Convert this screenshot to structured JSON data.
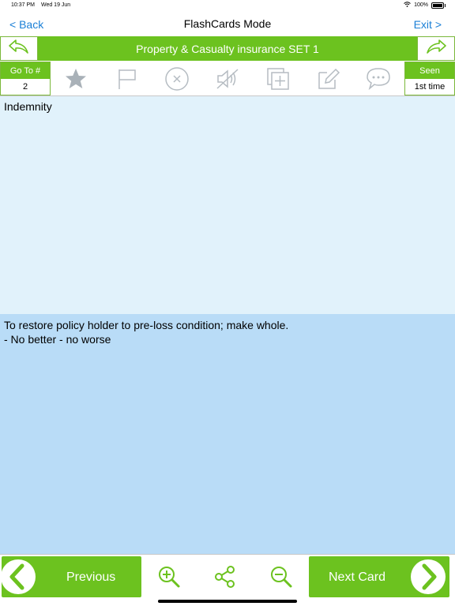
{
  "status": {
    "time": "10:37 PM",
    "date": "Wed 19 Jun",
    "battery": "100%",
    "battery_level": 1.0
  },
  "nav": {
    "back_label": "< Back",
    "title": "FlashCards Mode",
    "exit_label": "Exit >"
  },
  "set": {
    "title": "Property & Casualty insurance SET 1"
  },
  "goto": {
    "label": "Go To #",
    "value": "2"
  },
  "seen": {
    "label": "Seen",
    "value": "1st time"
  },
  "tools": [
    "star-icon",
    "flag-icon",
    "close-circle-icon",
    "mute-icon",
    "copy-add-icon",
    "edit-icon",
    "comment-icon"
  ],
  "card": {
    "question": "Indemnity",
    "answer": "To restore policy holder to pre-loss condition; make whole.\n- No better - no worse"
  },
  "bottom": {
    "previous_label": "Previous",
    "next_label": "Next Card"
  },
  "colors": {
    "accent_green": "#6cc21f",
    "question_bg": "#e1f2fb",
    "answer_bg": "#b9dcf7",
    "link_blue": "#1a7fd6",
    "icon_gray": "#b5bcc2"
  }
}
